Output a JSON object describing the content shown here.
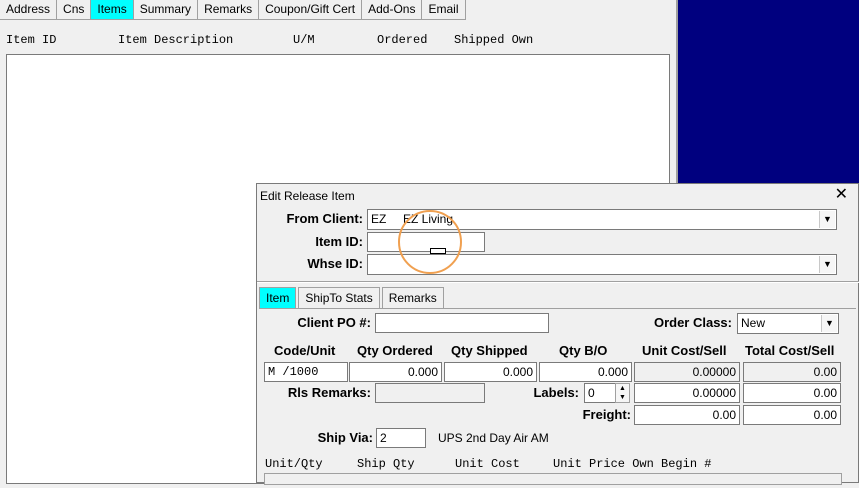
{
  "main": {
    "tabs": [
      {
        "label": "Address",
        "active": false
      },
      {
        "label": "Cns",
        "active": false
      },
      {
        "label": "Items",
        "active": true
      },
      {
        "label": "Summary",
        "active": false
      },
      {
        "label": "Remarks",
        "active": false
      },
      {
        "label": "Coupon/Gift Cert",
        "active": false
      },
      {
        "label": "Add-Ons",
        "active": false
      },
      {
        "label": "Email",
        "active": false
      }
    ],
    "columns": [
      "Item ID",
      "Item Description",
      "U/M",
      "Ordered",
      "Shipped Own"
    ]
  },
  "dialog": {
    "title": "Edit Release Item",
    "close_glyph": "✕",
    "from_client_label": "From Client:",
    "from_client_value": "EZ     EZ Living",
    "item_id_label": "Item ID:",
    "item_id_value": "",
    "whse_id_label": "Whse ID:",
    "whse_id_value": "",
    "tabs": [
      {
        "label": "Item",
        "active": true
      },
      {
        "label": "ShipTo Stats",
        "active": false
      },
      {
        "label": "Remarks",
        "active": false
      }
    ],
    "item_tab": {
      "client_po_label": "Client PO #:",
      "client_po_value": "",
      "order_class_label": "Order Class:",
      "order_class_value": "New",
      "col_headers": [
        "Code/Unit",
        "Qty Ordered",
        "Qty Shipped",
        "Qty B/O",
        "Unit Cost/Sell",
        "Total Cost/Sell"
      ],
      "row1": {
        "code_unit": "M /1000",
        "qty_ordered": "0.000",
        "qty_shipped": "0.000",
        "qty_bo": "0.000",
        "unit_cost": "0.00000",
        "total_cost": "0.00"
      },
      "rls_remarks_label": "Rls Remarks:",
      "rls_remarks_value": "",
      "labels_label": "Labels:",
      "labels_value": "0",
      "unit_sell": "0.00000",
      "total_sell": "0.00",
      "freight_label": "Freight:",
      "freight_value": "0.00",
      "freight_total": "0.00",
      "ship_via_label": "Ship Via:",
      "ship_via_value": "2",
      "ship_via_desc": "UPS 2nd Day Air AM",
      "grid_columns": [
        "Unit/Qty",
        "Ship Qty",
        "Unit Cost",
        "Unit Price Own Begin #"
      ]
    }
  },
  "icons": {
    "dropdown": "chevron-down-icon",
    "close": "close-icon",
    "spinner": "spin-icon"
  }
}
